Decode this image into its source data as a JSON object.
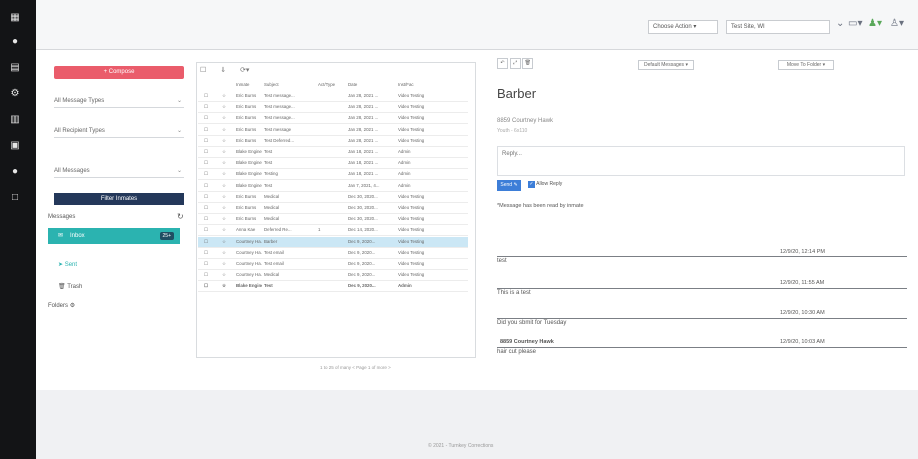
{
  "rail": {
    "icons": [
      "grid-icon",
      "dot-icon",
      "panel-icon",
      "settings-icon",
      "chart-icon",
      "doc-icon",
      "chat-icon",
      "box-icon"
    ]
  },
  "topbar": {
    "choose_action": "Choose Action",
    "site_select": "Test Site, WI",
    "icons": [
      "dropdown-icon",
      "monitor-icon",
      "user-plus-icon",
      "user-icon"
    ]
  },
  "left": {
    "compose": "+ Compose",
    "message_types": "All Message Types",
    "recipient_types": "All Recipient Types",
    "messages_filter": "All Messages",
    "filter_inmates": "Filter Inmates",
    "messages_label": "Messages",
    "inbox": "Inbox",
    "inbox_badge": "25+",
    "sent": "Sent",
    "trash": "Trash",
    "folders": "Folders"
  },
  "table": {
    "toolbar": [
      "☐",
      "⇓",
      "⟳▾"
    ],
    "headers": [
      "",
      "",
      "Inmate",
      "Subject",
      "Act/Type",
      "Date",
      "Inst/Fac"
    ],
    "rows": [
      [
        "☐",
        "☆",
        "Eric Burns",
        "Test message...",
        "",
        "Jan 28, 2021 ...",
        "Video Testing"
      ],
      [
        "☐",
        "☆",
        "Eric Burns",
        "Test message...",
        "",
        "Jan 28, 2021 ...",
        "Video Testing"
      ],
      [
        "☐",
        "☆",
        "Eric Burns",
        "Test message...",
        "",
        "Jan 28, 2021 ...",
        "Video Testing"
      ],
      [
        "☐",
        "☆",
        "Eric Burns",
        "Test message",
        "",
        "Jan 28, 2021 ...",
        "Video Testing"
      ],
      [
        "☐",
        "☆",
        "Eric Burns",
        "Test Deferred...",
        "",
        "Jan 28, 2021 ...",
        "Video Testing"
      ],
      [
        "☐",
        "☆",
        "Blake Engine",
        "Test",
        "",
        "Jan 18, 2021 ...",
        "Admin"
      ],
      [
        "☐",
        "☆",
        "Blake Engine",
        "Test",
        "",
        "Jan 18, 2021 ...",
        "Admin"
      ],
      [
        "☐",
        "☆",
        "Blake Engine",
        "Testing",
        "",
        "Jan 18, 2021 ...",
        "Admin"
      ],
      [
        "☐",
        "☆",
        "Blake Engine",
        "Test",
        "",
        "Jan 7, 2021, 4...",
        "Admin"
      ],
      [
        "☐",
        "☆",
        "Eric Burns",
        "Medical",
        "",
        "Dec 30, 2020...",
        "Video Testing"
      ],
      [
        "☐",
        "☆",
        "Eric Burns",
        "Medical",
        "",
        "Dec 30, 2020...",
        "Video Testing"
      ],
      [
        "☐",
        "☆",
        "Eric Burns",
        "Medical",
        "",
        "Dec 30, 2020...",
        "Video Testing"
      ],
      [
        "☐",
        "☆",
        "Anna Kae",
        "Deferred Re...",
        "1",
        "Dec 14, 2020...",
        "Video Testing"
      ],
      [
        "☐",
        "☆",
        "Courtney Ha...",
        "Barber",
        "",
        "Dec 9, 2020...",
        "Video Testing"
      ],
      [
        "☐",
        "☆",
        "Courtney Ha...",
        "Test email",
        "",
        "Dec 9, 2020...",
        "Video Testing"
      ],
      [
        "☐",
        "☆",
        "Courtney Ha...",
        "Test email",
        "",
        "Dec 9, 2020...",
        "Video Testing"
      ],
      [
        "☐",
        "☆",
        "Courtney Ha...",
        "Medical",
        "",
        "Dec 9, 2020...",
        "Video Testing"
      ],
      [
        "☐",
        "☆",
        "Blake Engine",
        "Test",
        "",
        "Dec 9, 2020...",
        "Admin"
      ]
    ],
    "pager": "1 to 25 of many   <  Page 1 of more  >"
  },
  "detail": {
    "toolbar": [
      "↶",
      "⤢",
      "🗑"
    ],
    "default_messages": "Default Messages",
    "move_to_folder": "Move To Folder",
    "subject": "Barber",
    "from_name": "8859 Courtney Hawk",
    "from_meta": "Youth - 6x110",
    "reply_placeholder": "Reply...",
    "send_label": "Send",
    "allow_reply": "Allow Reply",
    "read_notice": "*Message has been read by inmate",
    "thread": [
      {
        "time": "12/9/20, 12:14 PM",
        "text": "test"
      },
      {
        "time": "12/9/20, 11:55 AM",
        "text": "This is a test"
      },
      {
        "time": "12/9/20, 10:30 AM",
        "text": "Did you sbmit for Tuesday"
      },
      {
        "time": "12/9/20, 10:03 AM",
        "sender": "8859 Courtney Hawk",
        "text": "hair cut please"
      }
    ]
  },
  "footer": {
    "copyright": "© 2021 - Turnkey Corrections"
  },
  "colors": {
    "accent_red": "#ea5c6b",
    "accent_teal": "#2bb3b0",
    "navy": "#24385a",
    "send_blue": "#3d7ed8"
  }
}
